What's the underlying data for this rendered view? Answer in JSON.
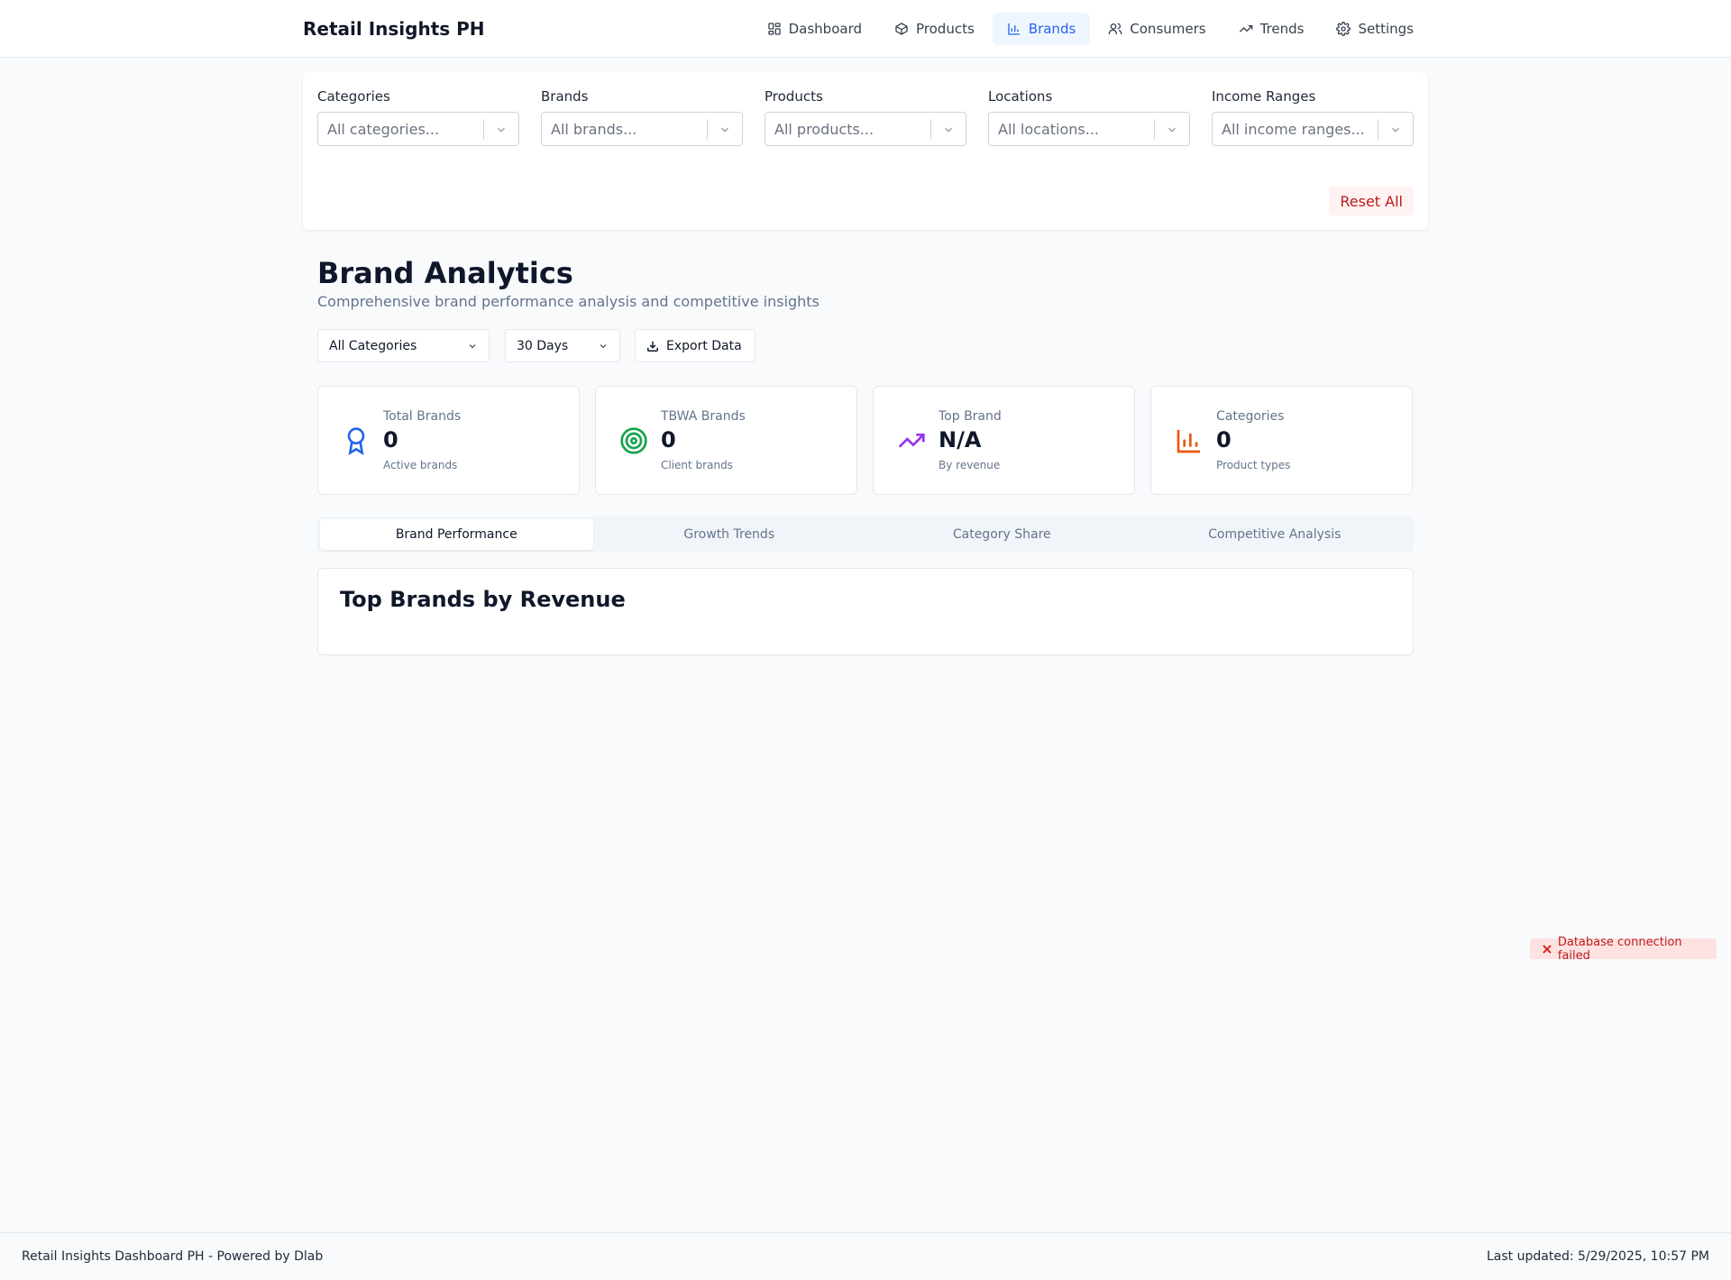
{
  "header": {
    "app_title": "Retail Insights PH",
    "nav": [
      {
        "label": "Dashboard",
        "icon": "grid-icon"
      },
      {
        "label": "Products",
        "icon": "box-icon"
      },
      {
        "label": "Brands",
        "icon": "bar-chart-icon",
        "active": true
      },
      {
        "label": "Consumers",
        "icon": "users-icon"
      },
      {
        "label": "Trends",
        "icon": "trending-up-icon"
      },
      {
        "label": "Settings",
        "icon": "gear-icon"
      }
    ]
  },
  "filters": {
    "items": [
      {
        "label": "Categories",
        "placeholder": "All categories..."
      },
      {
        "label": "Brands",
        "placeholder": "All brands..."
      },
      {
        "label": "Products",
        "placeholder": "All products..."
      },
      {
        "label": "Locations",
        "placeholder": "All locations..."
      },
      {
        "label": "Income Ranges",
        "placeholder": "All income ranges..."
      }
    ],
    "reset_label": "Reset All"
  },
  "page": {
    "title": "Brand Analytics",
    "subtitle": "Comprehensive brand performance analysis and competitive insights"
  },
  "controls": {
    "category_select": "All Categories",
    "period_select": "30 Days",
    "export_label": "Export Data"
  },
  "stats": [
    {
      "label": "Total Brands",
      "value": "0",
      "caption": "Active brands",
      "icon": "award-icon",
      "color": "#2563eb"
    },
    {
      "label": "TBWA Brands",
      "value": "0",
      "caption": "Client brands",
      "icon": "target-icon",
      "color": "#16a34a"
    },
    {
      "label": "Top Brand",
      "value": "N/A",
      "caption": "By revenue",
      "icon": "trending-up-icon",
      "color": "#9333ea"
    },
    {
      "label": "Categories",
      "value": "0",
      "caption": "Product types",
      "icon": "bar-chart-icon",
      "color": "#ea580c"
    }
  ],
  "tabs": [
    {
      "label": "Brand Performance",
      "active": true
    },
    {
      "label": "Growth Trends"
    },
    {
      "label": "Category Share"
    },
    {
      "label": "Competitive Analysis"
    }
  ],
  "chart_card": {
    "title": "Top Brands by Revenue"
  },
  "toast": {
    "message": "Database connection failed",
    "icon": "close-icon",
    "color": "#b91c1c"
  },
  "footer": {
    "left": "Retail Insights Dashboard PH - Powered by Dlab",
    "right": "Last updated: 5/29/2025, 10:57 PM"
  }
}
